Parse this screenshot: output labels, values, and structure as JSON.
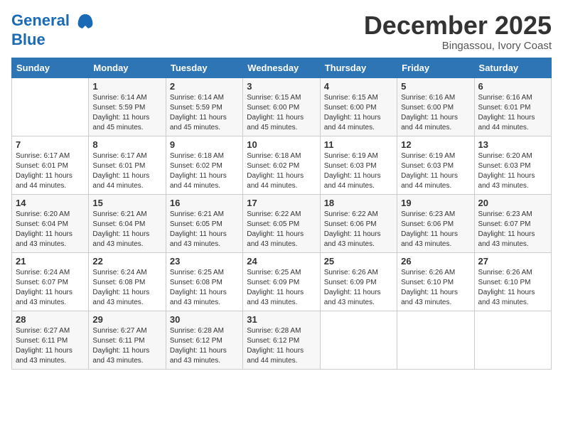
{
  "logo": {
    "line1": "General",
    "line2": "Blue"
  },
  "title": "December 2025",
  "subtitle": "Bingassou, Ivory Coast",
  "days_header": [
    "Sunday",
    "Monday",
    "Tuesday",
    "Wednesday",
    "Thursday",
    "Friday",
    "Saturday"
  ],
  "weeks": [
    [
      {
        "day": "",
        "info": ""
      },
      {
        "day": "1",
        "info": "Sunrise: 6:14 AM\nSunset: 5:59 PM\nDaylight: 11 hours\nand 45 minutes."
      },
      {
        "day": "2",
        "info": "Sunrise: 6:14 AM\nSunset: 5:59 PM\nDaylight: 11 hours\nand 45 minutes."
      },
      {
        "day": "3",
        "info": "Sunrise: 6:15 AM\nSunset: 6:00 PM\nDaylight: 11 hours\nand 45 minutes."
      },
      {
        "day": "4",
        "info": "Sunrise: 6:15 AM\nSunset: 6:00 PM\nDaylight: 11 hours\nand 44 minutes."
      },
      {
        "day": "5",
        "info": "Sunrise: 6:16 AM\nSunset: 6:00 PM\nDaylight: 11 hours\nand 44 minutes."
      },
      {
        "day": "6",
        "info": "Sunrise: 6:16 AM\nSunset: 6:01 PM\nDaylight: 11 hours\nand 44 minutes."
      }
    ],
    [
      {
        "day": "7",
        "info": "Sunrise: 6:17 AM\nSunset: 6:01 PM\nDaylight: 11 hours\nand 44 minutes."
      },
      {
        "day": "8",
        "info": "Sunrise: 6:17 AM\nSunset: 6:01 PM\nDaylight: 11 hours\nand 44 minutes."
      },
      {
        "day": "9",
        "info": "Sunrise: 6:18 AM\nSunset: 6:02 PM\nDaylight: 11 hours\nand 44 minutes."
      },
      {
        "day": "10",
        "info": "Sunrise: 6:18 AM\nSunset: 6:02 PM\nDaylight: 11 hours\nand 44 minutes."
      },
      {
        "day": "11",
        "info": "Sunrise: 6:19 AM\nSunset: 6:03 PM\nDaylight: 11 hours\nand 44 minutes."
      },
      {
        "day": "12",
        "info": "Sunrise: 6:19 AM\nSunset: 6:03 PM\nDaylight: 11 hours\nand 44 minutes."
      },
      {
        "day": "13",
        "info": "Sunrise: 6:20 AM\nSunset: 6:03 PM\nDaylight: 11 hours\nand 43 minutes."
      }
    ],
    [
      {
        "day": "14",
        "info": "Sunrise: 6:20 AM\nSunset: 6:04 PM\nDaylight: 11 hours\nand 43 minutes."
      },
      {
        "day": "15",
        "info": "Sunrise: 6:21 AM\nSunset: 6:04 PM\nDaylight: 11 hours\nand 43 minutes."
      },
      {
        "day": "16",
        "info": "Sunrise: 6:21 AM\nSunset: 6:05 PM\nDaylight: 11 hours\nand 43 minutes."
      },
      {
        "day": "17",
        "info": "Sunrise: 6:22 AM\nSunset: 6:05 PM\nDaylight: 11 hours\nand 43 minutes."
      },
      {
        "day": "18",
        "info": "Sunrise: 6:22 AM\nSunset: 6:06 PM\nDaylight: 11 hours\nand 43 minutes."
      },
      {
        "day": "19",
        "info": "Sunrise: 6:23 AM\nSunset: 6:06 PM\nDaylight: 11 hours\nand 43 minutes."
      },
      {
        "day": "20",
        "info": "Sunrise: 6:23 AM\nSunset: 6:07 PM\nDaylight: 11 hours\nand 43 minutes."
      }
    ],
    [
      {
        "day": "21",
        "info": "Sunrise: 6:24 AM\nSunset: 6:07 PM\nDaylight: 11 hours\nand 43 minutes."
      },
      {
        "day": "22",
        "info": "Sunrise: 6:24 AM\nSunset: 6:08 PM\nDaylight: 11 hours\nand 43 minutes."
      },
      {
        "day": "23",
        "info": "Sunrise: 6:25 AM\nSunset: 6:08 PM\nDaylight: 11 hours\nand 43 minutes."
      },
      {
        "day": "24",
        "info": "Sunrise: 6:25 AM\nSunset: 6:09 PM\nDaylight: 11 hours\nand 43 minutes."
      },
      {
        "day": "25",
        "info": "Sunrise: 6:26 AM\nSunset: 6:09 PM\nDaylight: 11 hours\nand 43 minutes."
      },
      {
        "day": "26",
        "info": "Sunrise: 6:26 AM\nSunset: 6:10 PM\nDaylight: 11 hours\nand 43 minutes."
      },
      {
        "day": "27",
        "info": "Sunrise: 6:26 AM\nSunset: 6:10 PM\nDaylight: 11 hours\nand 43 minutes."
      }
    ],
    [
      {
        "day": "28",
        "info": "Sunrise: 6:27 AM\nSunset: 6:11 PM\nDaylight: 11 hours\nand 43 minutes."
      },
      {
        "day": "29",
        "info": "Sunrise: 6:27 AM\nSunset: 6:11 PM\nDaylight: 11 hours\nand 43 minutes."
      },
      {
        "day": "30",
        "info": "Sunrise: 6:28 AM\nSunset: 6:12 PM\nDaylight: 11 hours\nand 43 minutes."
      },
      {
        "day": "31",
        "info": "Sunrise: 6:28 AM\nSunset: 6:12 PM\nDaylight: 11 hours\nand 44 minutes."
      },
      {
        "day": "",
        "info": ""
      },
      {
        "day": "",
        "info": ""
      },
      {
        "day": "",
        "info": ""
      }
    ]
  ]
}
